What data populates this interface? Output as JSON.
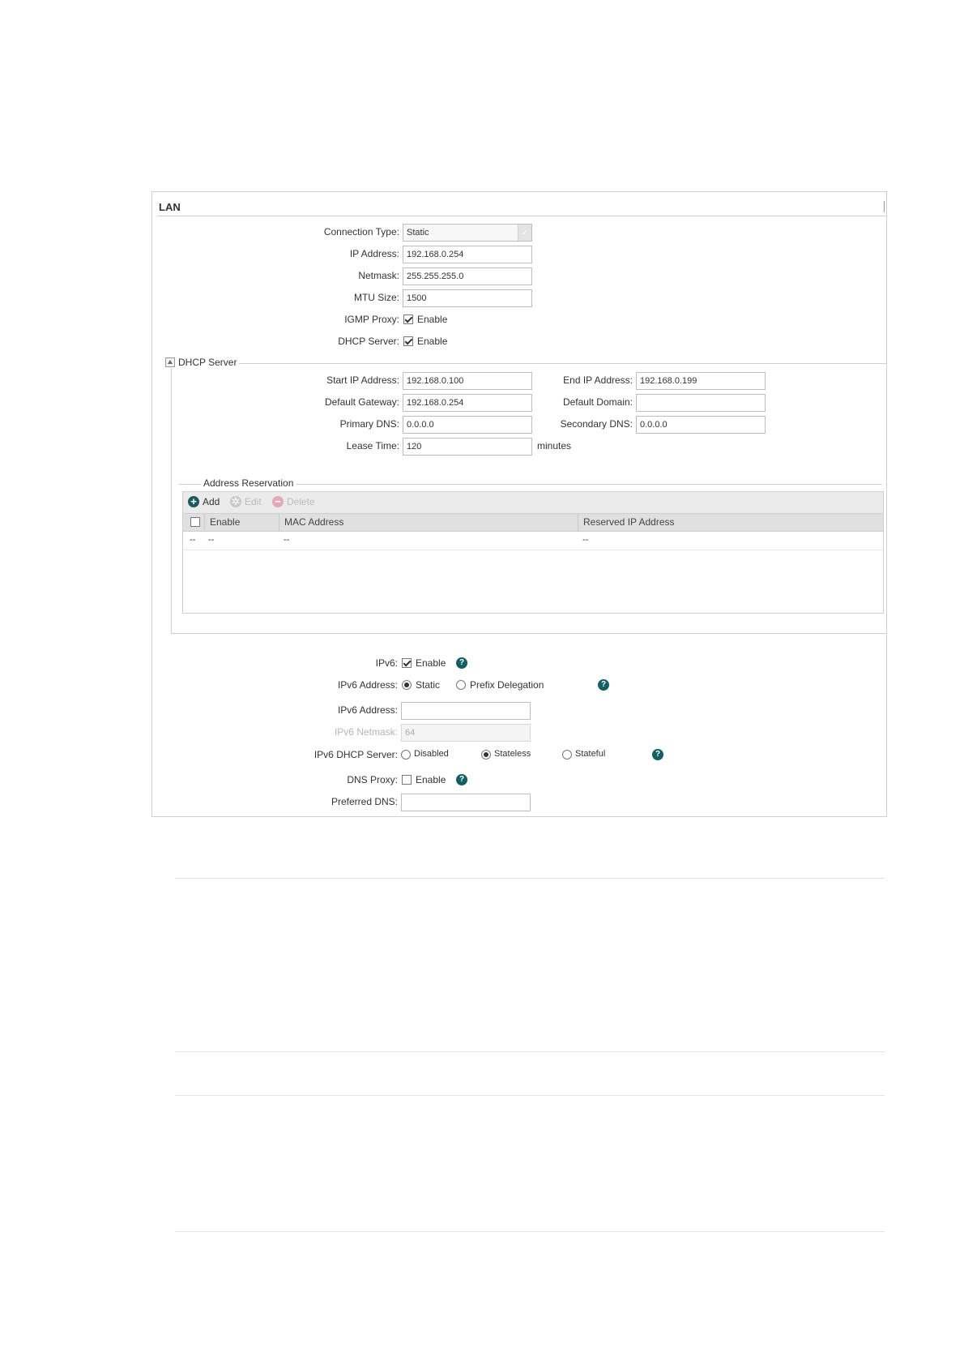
{
  "panel": {
    "title": "LAN",
    "connection_type": {
      "label": "Connection Type:",
      "value": "Static"
    },
    "ip_address": {
      "label": "IP Address:",
      "value": "192.168.0.254"
    },
    "netmask": {
      "label": "Netmask:",
      "value": "255.255.255.0"
    },
    "mtu_size": {
      "label": "MTU Size:",
      "value": "1500"
    },
    "igmp_proxy": {
      "label": "IGMP Proxy:",
      "option": "Enable",
      "checked": true
    },
    "dhcp_server": {
      "label": "DHCP Server:",
      "option": "Enable",
      "checked": true
    }
  },
  "dhcp": {
    "legend": "DHCP Server",
    "start_ip": {
      "label": "Start IP Address:",
      "value": "192.168.0.100"
    },
    "end_ip": {
      "label": "End IP Address:",
      "value": "192.168.0.199"
    },
    "default_gateway": {
      "label": "Default Gateway:",
      "value": "192.168.0.254"
    },
    "default_domain": {
      "label": "Default Domain:",
      "value": ""
    },
    "primary_dns": {
      "label": "Primary DNS:",
      "value": "0.0.0.0"
    },
    "secondary_dns": {
      "label": "Secondary DNS:",
      "value": "0.0.0.0"
    },
    "lease_time": {
      "label": "Lease Time:",
      "value": "120",
      "unit": "minutes"
    }
  },
  "reservation": {
    "legend": "Address Reservation",
    "toolbar": {
      "add": "Add",
      "edit": "Edit",
      "delete": "Delete"
    },
    "columns": {
      "enable": "Enable",
      "mac": "MAC Address",
      "reserved_ip": "Reserved IP Address"
    },
    "row": {
      "col0": "--",
      "enable": "--",
      "mac": "--",
      "reserved_ip": "--"
    }
  },
  "ipv6": {
    "ipv6": {
      "label": "IPv6:",
      "option": "Enable",
      "checked": true
    },
    "address_type": {
      "label": "IPv6 Address:",
      "options": [
        "Static",
        "Prefix Delegation"
      ],
      "selected": "Static"
    },
    "address": {
      "label": "IPv6 Address:",
      "value": ""
    },
    "netmask": {
      "label": "IPv6 Netmask:",
      "value": "64"
    },
    "dhcp_server": {
      "label": "IPv6 DHCP Server:",
      "options": [
        "Disabled",
        "Stateless",
        "Stateful"
      ],
      "selected": "Stateless"
    },
    "dns_proxy": {
      "label": "DNS Proxy:",
      "option": "Enable",
      "checked": false
    },
    "preferred_dns": {
      "label": "Preferred DNS:",
      "value": ""
    }
  },
  "help_icon_text": "?",
  "colors": {
    "help_icon": "#135f62",
    "add_icon": "#1d5b60",
    "edit_icon": "#c9c9c9",
    "delete_icon": "#e4a9b5"
  }
}
